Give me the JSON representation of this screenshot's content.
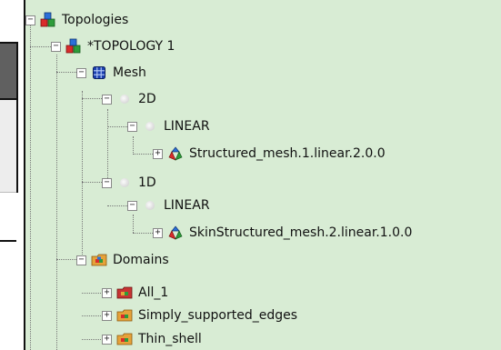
{
  "tree": {
    "topologies": {
      "label": "Topologies",
      "toggle": "−",
      "icon": "topologies-icon"
    },
    "topology1": {
      "label": "*TOPOLOGY 1",
      "toggle": "−",
      "icon": "topology-icon"
    },
    "mesh": {
      "label": "Mesh",
      "toggle": "−",
      "icon": "mesh-icon"
    },
    "dim2d": {
      "label": "2D",
      "toggle": "−",
      "icon": "dimension-icon"
    },
    "linear_2d": {
      "label": "LINEAR",
      "toggle": "−",
      "icon": "element-type-icon"
    },
    "structured_mesh": {
      "label": "Structured_mesh.1.linear.2.0.0",
      "toggle": "+",
      "icon": "mesh-part-icon"
    },
    "dim1d": {
      "label": "1D",
      "toggle": "−",
      "icon": "dimension-icon"
    },
    "linear_1d": {
      "label": "LINEAR",
      "toggle": "−",
      "icon": "element-type-icon"
    },
    "skin_structured_mesh": {
      "label": "SkinStructured_mesh.2.linear.1.0.0",
      "toggle": "+",
      "icon": "mesh-part-icon"
    },
    "domains": {
      "label": "Domains",
      "toggle": "−",
      "icon": "domains-folder-icon"
    },
    "all_1": {
      "label": "All_1",
      "toggle": "+",
      "icon": "domain-icon"
    },
    "simply_supported_edges": {
      "label": "Simply_supported_edges",
      "toggle": "+",
      "icon": "domain-icon"
    },
    "thin_shell": {
      "label": "Thin_shell",
      "toggle": "+",
      "icon": "domain-icon"
    }
  },
  "colors": {
    "tree_background": "#d8ecd4",
    "connector": "#777777"
  }
}
